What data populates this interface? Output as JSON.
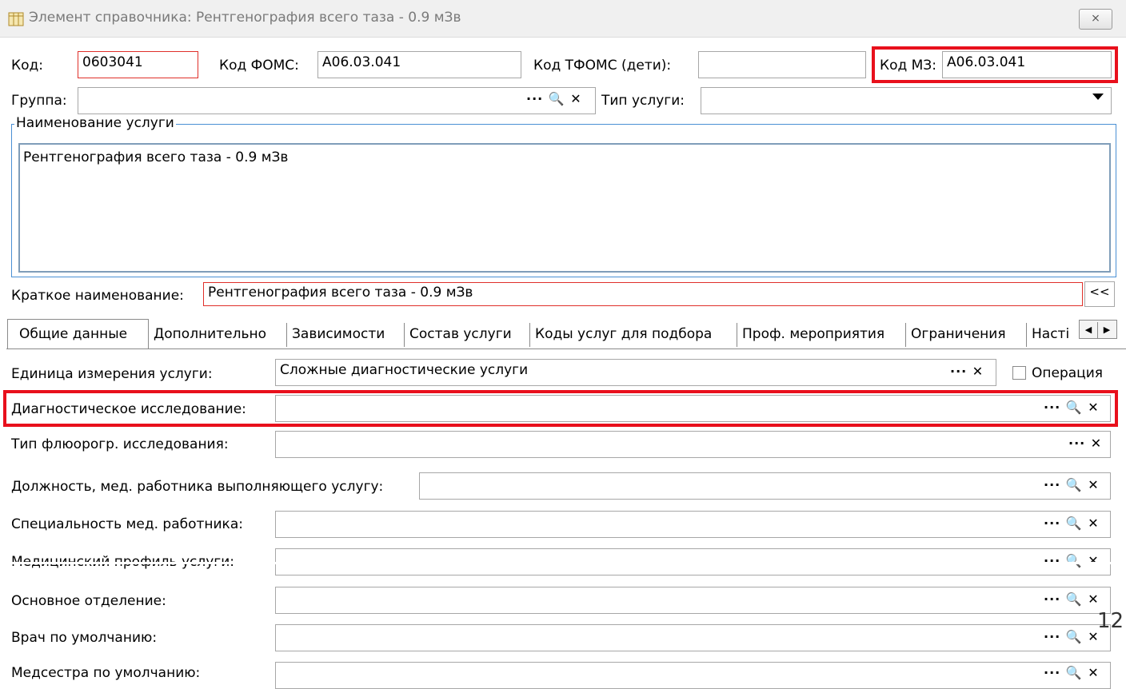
{
  "window": {
    "title": "Элемент справочника: Рентгенография всего таза - 0.9 мЗв",
    "close_glyph": "⨯"
  },
  "header": {
    "kod_label": "Код:",
    "kod_value": "0603041",
    "foms_label": "Код ФОМС:",
    "foms_value": "A06.03.041",
    "tfoms_label": "Код ТФОМС (дети):",
    "tfoms_value": "",
    "mz_label": "Код МЗ:",
    "mz_value": "A06.03.041",
    "group_label": "Группа:",
    "group_value": "",
    "group_buttons": "··· 🔍 ✕",
    "service_type_label": "Тип услуги:",
    "service_type_value": ""
  },
  "name_group": {
    "legend": "Наименование услуги",
    "value": "Рентгенография всего таза - 0.9 мЗв"
  },
  "short_name": {
    "label": "Краткое наименование:",
    "value": "Рентгенография всего таза - 0.9 мЗв",
    "button": "<<"
  },
  "tabs": [
    {
      "label": "Общие данные",
      "active": true
    },
    {
      "label": "Дополнительно"
    },
    {
      "label": "Зависимости"
    },
    {
      "label": "Состав услуги"
    },
    {
      "label": "Коды услуг для подбора"
    },
    {
      "label": "Проф. мероприятия"
    },
    {
      "label": "Ограничения"
    },
    {
      "label": "Насті"
    }
  ],
  "tab_scroll": {
    "left": "◀",
    "right": "▶"
  },
  "rows": [
    {
      "label": "Единица измерения услуги:",
      "value": "Сложные диагностические услуги",
      "buttons": "··· ✕"
    },
    {
      "label": "Диагностическое исследование:",
      "value": "",
      "buttons": "··· 🔍 ✕"
    },
    {
      "label": "Тип флюорогр. исследования:",
      "value": "",
      "buttons": "··· ✕"
    },
    {
      "label": "Должность, мед. работника выполняющего услугу:",
      "value": "",
      "buttons": "··· 🔍 ✕"
    },
    {
      "label": "Специальность мед. работника:",
      "value": "",
      "buttons": "··· 🔍 ✕"
    },
    {
      "label": "Медицинский профиль услуги:",
      "value": "",
      "buttons": "··· 🔍 ✕"
    },
    {
      "label": "Основное отделение:",
      "value": "",
      "buttons": "··· 🔍 ✕"
    },
    {
      "label": "Врач по умолчанию:",
      "value": "",
      "buttons": "··· 🔍 ✕"
    },
    {
      "label": "Медсестра по умолчанию:",
      "value": "",
      "buttons": "··· 🔍 ✕"
    }
  ],
  "operation_checkbox": {
    "label": "Операция",
    "checked": false
  },
  "page_number": "12",
  "colors": {
    "highlight": "#e8101c",
    "required_border": "#e0302a",
    "group_border": "#4a90d4"
  }
}
